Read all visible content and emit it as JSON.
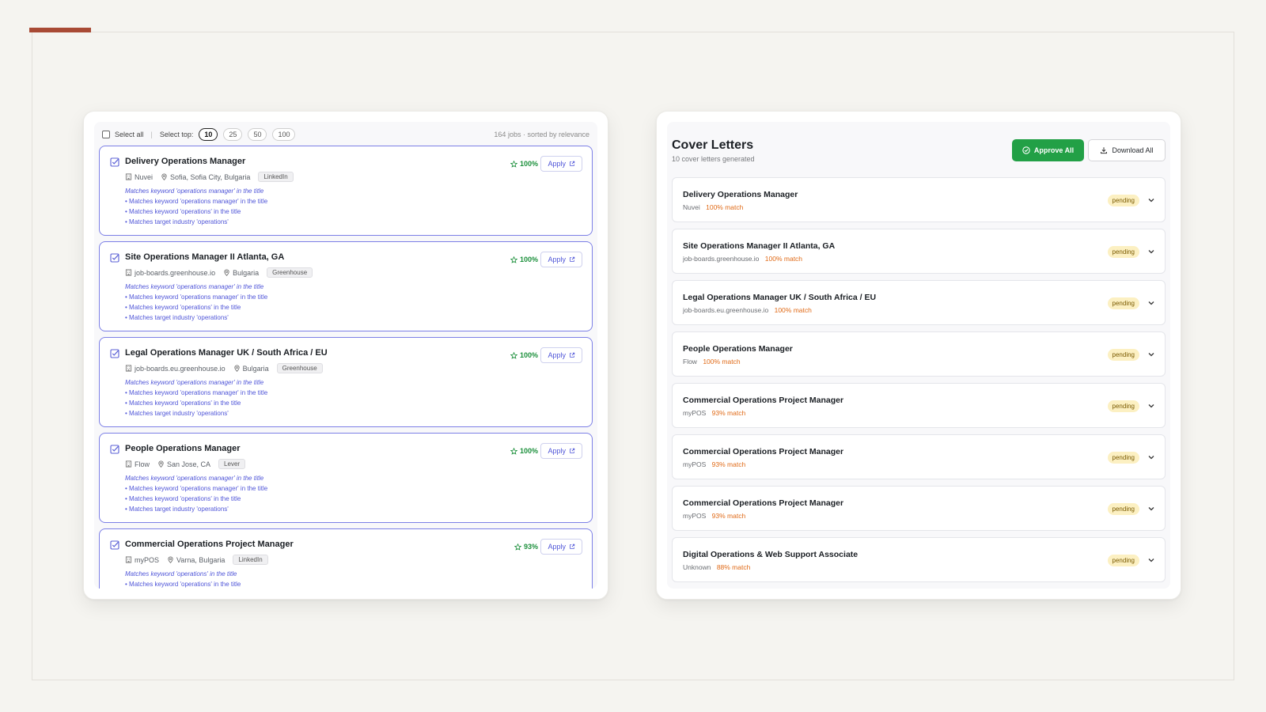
{
  "job_panel": {
    "select_all_label": "Select all",
    "select_top_label": "Select top:",
    "select_top_options": [
      "10",
      "25",
      "50",
      "100"
    ],
    "select_top_active": "10",
    "summary": "164 jobs · sorted by relevance",
    "apply_label": "Apply",
    "jobs": [
      {
        "title": "Delivery Operations Manager",
        "company": "Nuvei",
        "location": "Sofia, Sofia City, Bulgaria",
        "source": "LinkedIn",
        "score": "100%",
        "reasons": [
          "Matches keyword 'operations manager' in the title",
          "• Matches keyword 'operations manager' in the title",
          "• Matches keyword 'operations' in the title",
          "• Matches target industry 'operations'"
        ]
      },
      {
        "title": "Site Operations Manager II Atlanta, GA",
        "company": "job-boards.greenhouse.io",
        "location": "Bulgaria",
        "source": "Greenhouse",
        "score": "100%",
        "reasons": [
          "Matches keyword 'operations manager' in the title",
          "• Matches keyword 'operations manager' in the title",
          "• Matches keyword 'operations' in the title",
          "• Matches target industry 'operations'"
        ]
      },
      {
        "title": "Legal Operations Manager UK / South Africa / EU",
        "company": "job-boards.eu.greenhouse.io",
        "location": "Bulgaria",
        "source": "Greenhouse",
        "score": "100%",
        "reasons": [
          "Matches keyword 'operations manager' in the title",
          "• Matches keyword 'operations manager' in the title",
          "• Matches keyword 'operations' in the title",
          "• Matches target industry 'operations'"
        ]
      },
      {
        "title": "People Operations Manager",
        "company": "Flow",
        "location": "San Jose, CA",
        "source": "Lever",
        "score": "100%",
        "reasons": [
          "Matches keyword 'operations manager' in the title",
          "• Matches keyword 'operations manager' in the title",
          "• Matches keyword 'operations' in the title",
          "• Matches target industry 'operations'"
        ]
      },
      {
        "title": "Commercial Operations Project Manager",
        "company": "myPOS",
        "location": "Varna, Bulgaria",
        "source": "LinkedIn",
        "score": "93%",
        "reasons": [
          "Matches keyword 'operations' in the title",
          "• Matches keyword 'operations' in the title"
        ]
      }
    ]
  },
  "cover_panel": {
    "title": "Cover Letters",
    "subtitle": "10 cover letters generated",
    "approve_all_label": "Approve All",
    "download_all_label": "Download All",
    "status_label": "pending",
    "items": [
      {
        "title": "Delivery Operations Manager",
        "company": "Nuvei",
        "match": "100% match"
      },
      {
        "title": "Site Operations Manager II Atlanta, GA",
        "company": "job-boards.greenhouse.io",
        "match": "100% match"
      },
      {
        "title": "Legal Operations Manager UK / South Africa / EU",
        "company": "job-boards.eu.greenhouse.io",
        "match": "100% match"
      },
      {
        "title": "People Operations Manager",
        "company": "Flow",
        "match": "100% match"
      },
      {
        "title": "Commercial Operations Project Manager",
        "company": "myPOS",
        "match": "93% match"
      },
      {
        "title": "Commercial Operations Project Manager",
        "company": "myPOS",
        "match": "93% match"
      },
      {
        "title": "Commercial Operations Project Manager",
        "company": "myPOS",
        "match": "93% match"
      },
      {
        "title": "Digital Operations & Web Support Associate",
        "company": "Unknown",
        "match": "88% match"
      }
    ]
  },
  "colors": {
    "accent_bar": "#a84a35",
    "card_border": "#7c7fe6",
    "reason_text": "#4f55d8",
    "score_green": "#1a8f3a",
    "approve_green": "#22a046",
    "match_orange": "#e06a17",
    "pending_bg": "#fcf0c2"
  },
  "icons": {
    "job_checkbox": "check-square-icon",
    "company": "building-icon",
    "location": "map-pin-icon",
    "score": "star-icon",
    "apply": "external-link-icon",
    "approve": "check-circle-icon",
    "download": "download-icon",
    "expand": "chevron-down-icon"
  }
}
